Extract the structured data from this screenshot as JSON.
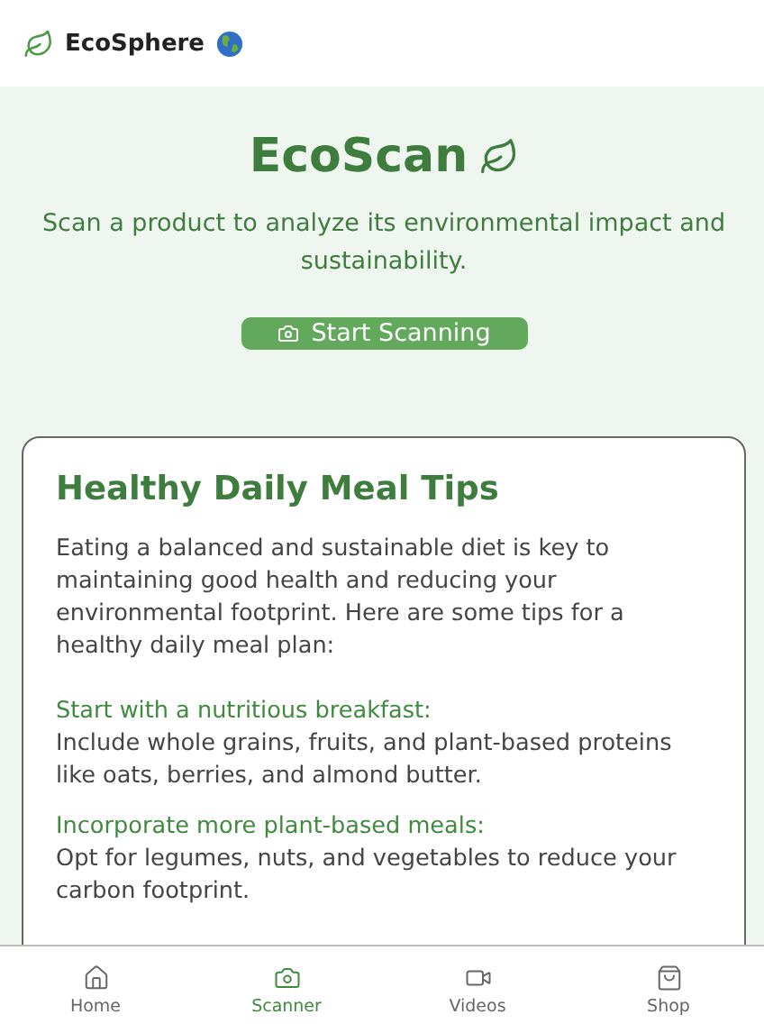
{
  "header": {
    "brand": "EcoSphere"
  },
  "hero": {
    "title": "EcoScan",
    "subtitle": "Scan a product to analyze its environmental impact and sustainability.",
    "button": "Start Scanning"
  },
  "card": {
    "title": "Healthy Daily Meal Tips",
    "intro": "Eating a balanced and sustainable diet is key to maintaining good health and reducing your environmental footprint. Here are some tips for a healthy daily meal plan:",
    "tips": [
      {
        "heading": "Start with a nutritious breakfast:",
        "text": "Include whole grains, fruits, and plant-based proteins like oats, berries, and almond butter."
      },
      {
        "heading": "Incorporate more plant-based meals:",
        "text": "Opt for legumes, nuts, and vegetables to reduce your carbon footprint."
      }
    ]
  },
  "nav": [
    {
      "kind": "home",
      "label": "Home",
      "selected": false
    },
    {
      "kind": "scanner",
      "label": "Scanner",
      "selected": true
    },
    {
      "kind": "videos",
      "label": "Videos",
      "selected": false
    },
    {
      "kind": "shop",
      "label": "Shop",
      "selected": false
    }
  ]
}
